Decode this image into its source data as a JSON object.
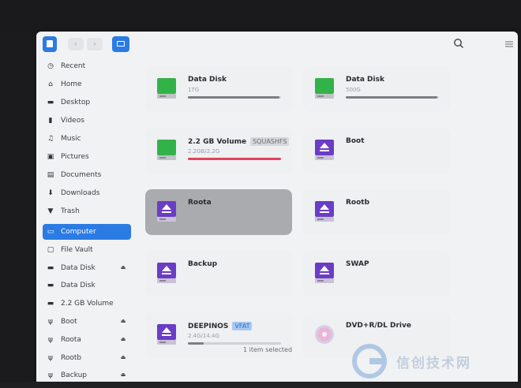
{
  "sidebar": {
    "items": [
      {
        "label": "Recent",
        "icon": "clock-icon",
        "glyph": "◷"
      },
      {
        "label": "Home",
        "icon": "home-icon",
        "glyph": "⌂"
      },
      {
        "label": "Desktop",
        "icon": "desktop-icon",
        "glyph": "▬"
      },
      {
        "label": "Videos",
        "icon": "video-icon",
        "glyph": "▮"
      },
      {
        "label": "Music",
        "icon": "music-icon",
        "glyph": "♫"
      },
      {
        "label": "Pictures",
        "icon": "picture-icon",
        "glyph": "▣"
      },
      {
        "label": "Documents",
        "icon": "document-icon",
        "glyph": "▤"
      },
      {
        "label": "Downloads",
        "icon": "download-icon",
        "glyph": "⬇"
      },
      {
        "label": "Trash",
        "icon": "trash-icon",
        "glyph": "▼"
      },
      {
        "label": "Computer",
        "icon": "computer-icon",
        "glyph": "▭"
      },
      {
        "label": "File Vault",
        "icon": "vault-icon",
        "glyph": "▢"
      },
      {
        "label": "Data Disk",
        "icon": "disk-icon",
        "glyph": "▬"
      },
      {
        "label": "Data Disk",
        "icon": "disk-icon",
        "glyph": "▬"
      },
      {
        "label": "2.2 GB Volume",
        "icon": "disk-icon",
        "glyph": "▬"
      },
      {
        "label": "Boot",
        "icon": "usb-icon",
        "glyph": "ψ"
      },
      {
        "label": "Roota",
        "icon": "usb-icon",
        "glyph": "ψ"
      },
      {
        "label": "Rootb",
        "icon": "usb-icon",
        "glyph": "ψ"
      },
      {
        "label": "Backup",
        "icon": "usb-icon",
        "glyph": "ψ"
      }
    ],
    "eject_glyph": "⏏",
    "active_index": 9
  },
  "devices": [
    {
      "name": "Data Disk",
      "tag": "",
      "sub": "1TG",
      "kind": "hdd",
      "usage": 0.98
    },
    {
      "name": "Data Disk",
      "tag": "",
      "sub": "500G",
      "kind": "hdd",
      "usage": 0.98
    },
    {
      "name": "2.2 GB Volume",
      "tag": "SQUASHFS",
      "sub": "2.2GB/2.2G",
      "kind": "hdd",
      "usage": 1.0
    },
    {
      "name": "Boot",
      "tag": "",
      "sub": "",
      "kind": "removable"
    },
    {
      "name": "Roota",
      "tag": "",
      "sub": "",
      "kind": "removable"
    },
    {
      "name": "Rootb",
      "tag": "",
      "sub": "",
      "kind": "removable"
    },
    {
      "name": "Backup",
      "tag": "",
      "sub": "",
      "kind": "removable"
    },
    {
      "name": "SWAP",
      "tag": "",
      "sub": "",
      "kind": "removable"
    },
    {
      "name": "DEEPINOS",
      "tag": "VFAT",
      "sub": "2.4G/14.4G",
      "kind": "removable",
      "usage": 0.17
    },
    {
      "name": "DVD+R/DL Drive",
      "tag": "",
      "sub": "",
      "kind": "optical"
    }
  ],
  "status": {
    "text": "1 item selected"
  },
  "watermark": {
    "text": "信创技术网"
  },
  "colors": {
    "accent": "#2a7be4",
    "removable": "#6a3dc6",
    "hdd": "#34b24a",
    "usage_full": "#e4425a"
  }
}
